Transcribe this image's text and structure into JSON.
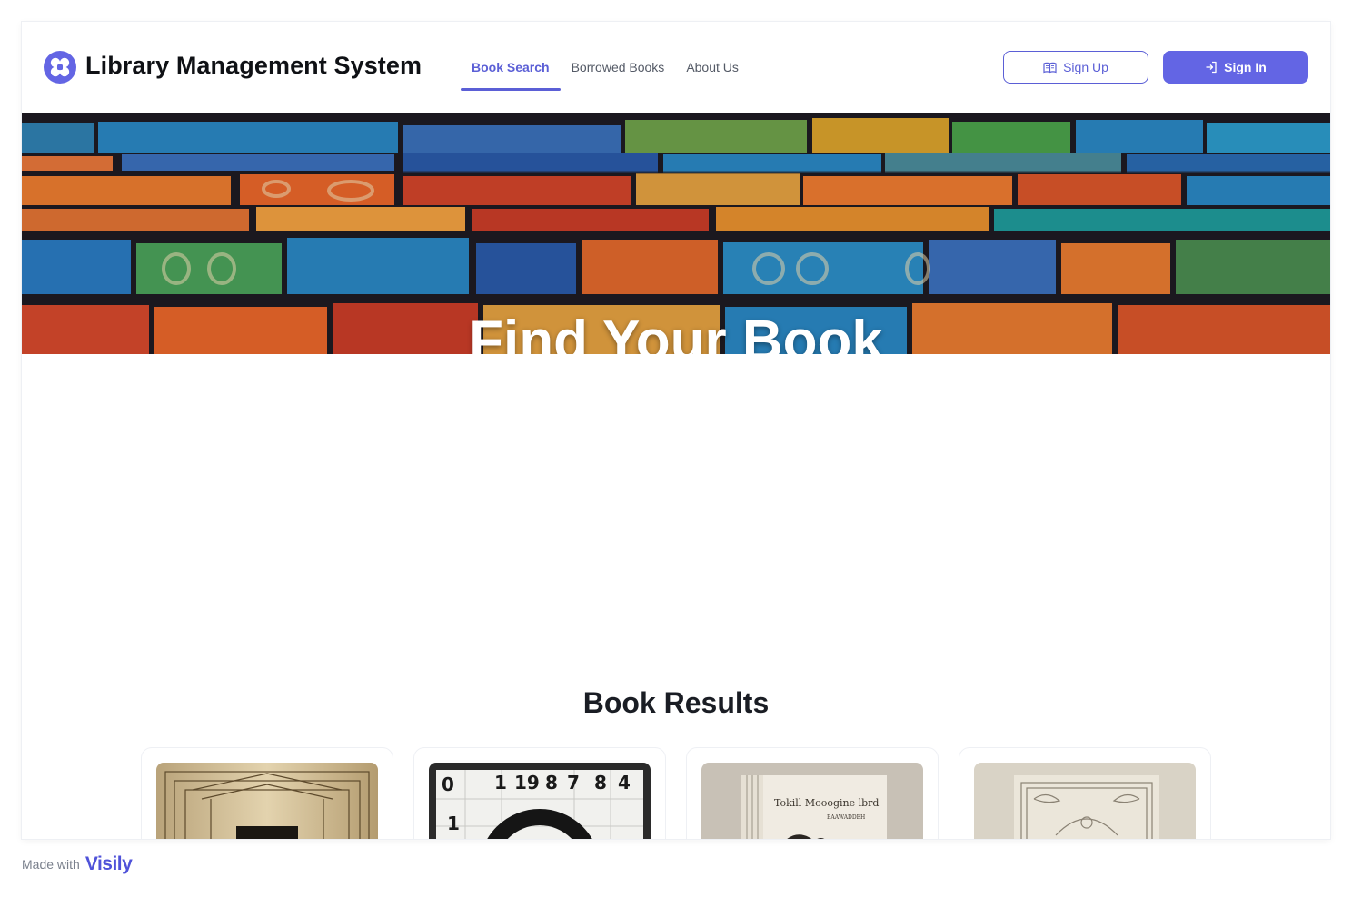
{
  "header": {
    "title": "Library Management System",
    "logo_icon": "flower-logo-icon",
    "nav": [
      {
        "label": "Book Search",
        "active": true
      },
      {
        "label": "Borrowed Books",
        "active": false
      },
      {
        "label": "About Us",
        "active": false
      }
    ],
    "signup_label": "Sign Up",
    "signup_icon": "book-open-icon",
    "signin_label": "Sign In",
    "signin_icon": "login-arrow-icon"
  },
  "hero": {
    "title": "Find Your Book",
    "image": "colorful-bookshelf-image"
  },
  "results": {
    "title": "Book Results",
    "books": [
      {
        "cover": "art-deco-gold-cover"
      },
      {
        "cover": "numbers-grid-cover"
      },
      {
        "cover": "mockingbird-cover",
        "cover_text": "Tokill Mooogine lbrd",
        "cover_subtext": "BAAWADDEH"
      },
      {
        "cover": "ornate-frame-cover"
      }
    ]
  },
  "footer": {
    "made_with": "Made with",
    "brand": "Visily"
  },
  "colors": {
    "accent": "#6365e4",
    "text": "#0f1115",
    "muted": "#545a66"
  }
}
